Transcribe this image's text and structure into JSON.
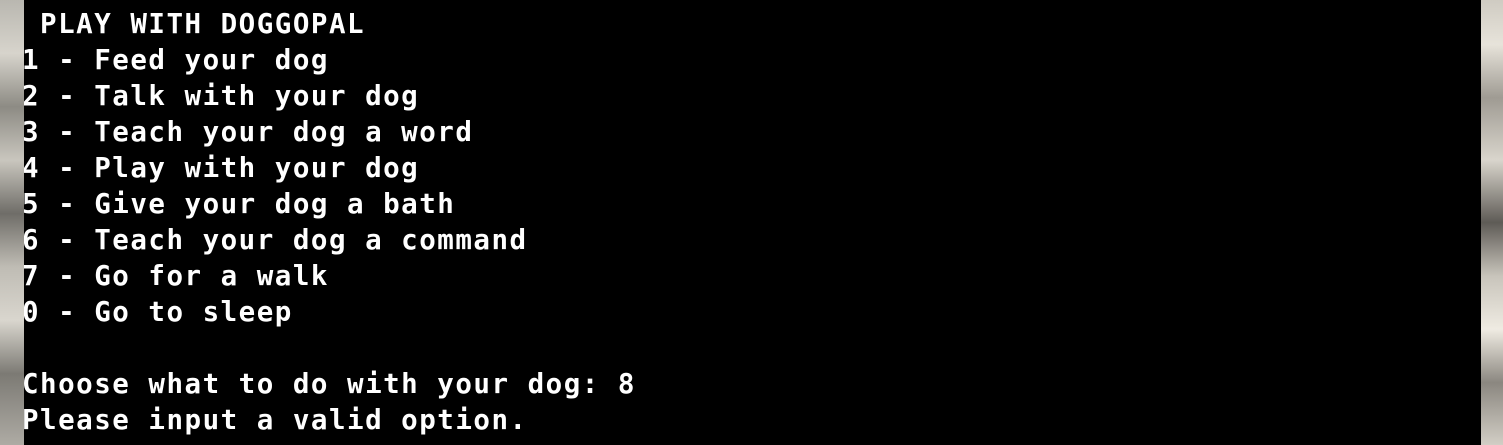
{
  "terminal": {
    "title_line": " PLAY WITH DOGGOPAL",
    "menu": [
      {
        "line": "1 - Feed your dog"
      },
      {
        "line": "2 - Talk with your dog"
      },
      {
        "line": "3 - Teach your dog a word"
      },
      {
        "line": "4 - Play with your dog"
      },
      {
        "line": "5 - Give your dog a bath"
      },
      {
        "line": "6 - Teach your dog a command"
      },
      {
        "line": "7 - Go for a walk"
      },
      {
        "line": "0 - Go to sleep"
      }
    ],
    "prompt": "Choose what to do with your dog: ",
    "input_value": "8",
    "message": "Please input a valid option."
  }
}
